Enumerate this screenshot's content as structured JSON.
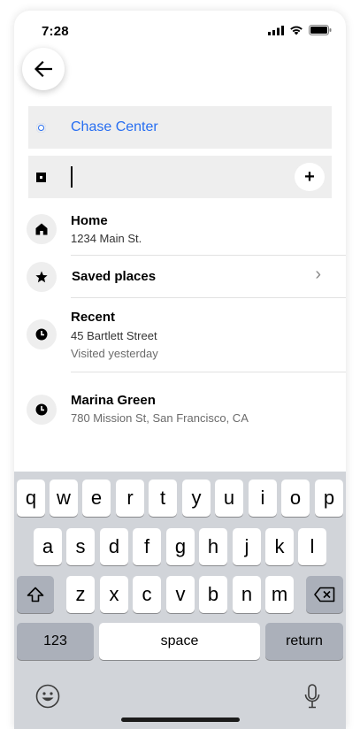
{
  "status_bar": {
    "time": "7:28"
  },
  "trip": {
    "pickup": "Chase Center",
    "destination_value": "",
    "destination_placeholder": ""
  },
  "list": {
    "home": {
      "title": "Home",
      "address": "1234 Main St."
    },
    "saved": {
      "title": "Saved places"
    },
    "recent": {
      "title": "Recent",
      "address": "45 Bartlett Street",
      "note": "Visited yesterday"
    },
    "marina": {
      "title": "Marina Green",
      "address": "780 Mission St, San Francisco, CA"
    }
  },
  "keyboard": {
    "row1": [
      "q",
      "w",
      "e",
      "r",
      "t",
      "y",
      "u",
      "i",
      "o",
      "p"
    ],
    "row2": [
      "a",
      "s",
      "d",
      "f",
      "g",
      "h",
      "j",
      "k",
      "l"
    ],
    "row3": [
      "z",
      "x",
      "c",
      "v",
      "b",
      "n",
      "m"
    ],
    "numbers_label": "123",
    "space_label": "space",
    "return_label": "return"
  },
  "colors": {
    "accent": "#276ef1",
    "field_bg": "#eeeeee",
    "keyboard_bg": "#d1d4d9"
  },
  "icons": [
    "back-arrow-icon",
    "pickup-dot-icon",
    "destination-square-icon",
    "plus-icon",
    "home-icon",
    "star-icon",
    "clock-icon",
    "chevron-right-icon",
    "shift-icon",
    "backspace-icon",
    "emoji-icon",
    "microphone-icon"
  ]
}
